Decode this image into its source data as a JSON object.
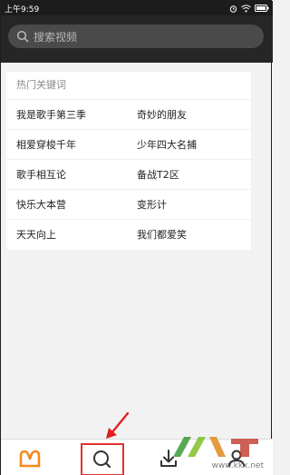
{
  "status_bar": {
    "time": "上午9:59",
    "icons": [
      "alarm-icon",
      "wifi-icon",
      "battery-icon"
    ]
  },
  "search": {
    "placeholder": "搜索视频",
    "icon": "search-icon"
  },
  "hot_keywords": {
    "title": "热门关键词",
    "rows": [
      [
        "我是歌手第三季",
        "奇妙的朋友"
      ],
      [
        "相爱穿梭千年",
        "少年四大名捕"
      ],
      [
        "歌手相互论",
        "备战T2区"
      ],
      [
        "快乐大本营",
        "变形计"
      ],
      [
        "天天向上",
        "我们都爱笑"
      ]
    ]
  },
  "bottom_nav": {
    "items": [
      "home-icon",
      "search-icon",
      "download-icon",
      "profile-icon"
    ],
    "selected": "search-icon"
  },
  "watermark": {
    "text": "www.kkx.net"
  },
  "colors": {
    "top_bar": "#262626",
    "accent_orange": "#f5891e",
    "highlight_red": "#e23030"
  }
}
